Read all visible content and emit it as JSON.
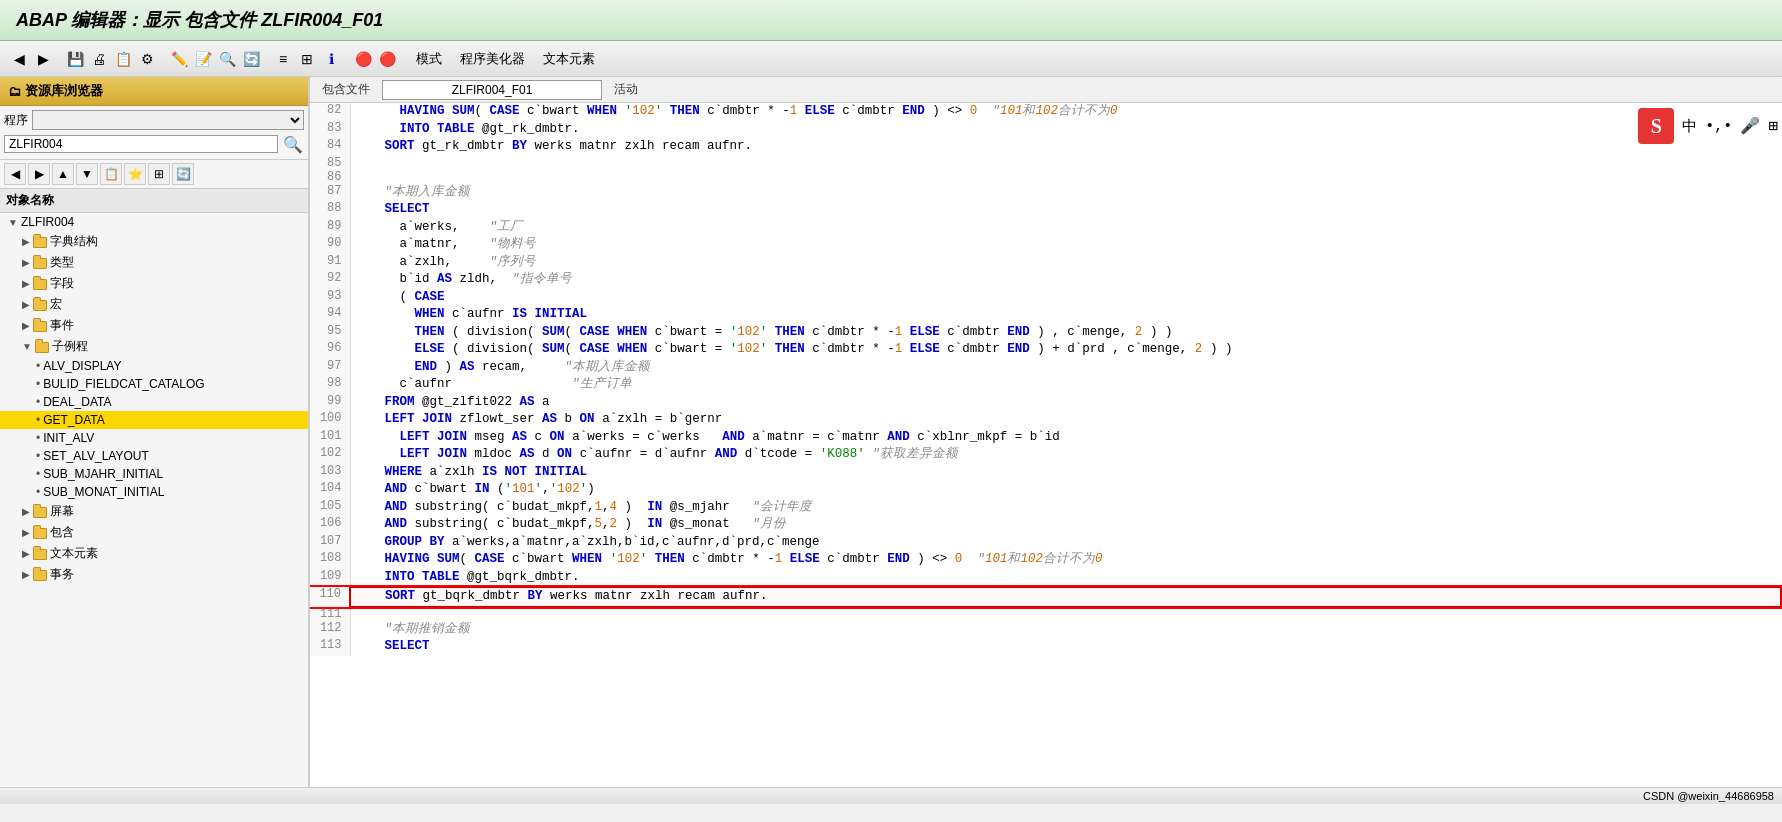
{
  "title": "ABAP 编辑器：显示 包含文件 ZLFIR004_F01",
  "toolbar": {
    "menu_items": [
      "模式",
      "程序美化器",
      "文本元素"
    ]
  },
  "sidebar": {
    "header": "资源库浏览器",
    "program_label": "程序",
    "program_value": "ZLFIR004",
    "object_label": "对象名称",
    "tree": [
      {
        "id": "root",
        "label": "ZLFIR004",
        "indent": 0,
        "selected": false,
        "arrow": "▼"
      },
      {
        "id": "dict",
        "label": "字典结构",
        "indent": 1,
        "arrow": "▶"
      },
      {
        "id": "types",
        "label": "类型",
        "indent": 1,
        "arrow": "▶"
      },
      {
        "id": "fields",
        "label": "字段",
        "indent": 1,
        "arrow": "▶"
      },
      {
        "id": "macros",
        "label": "宏",
        "indent": 1,
        "arrow": "▶"
      },
      {
        "id": "events",
        "label": "事件",
        "indent": 1,
        "arrow": "▶"
      },
      {
        "id": "subroutines",
        "label": "子例程",
        "indent": 1,
        "arrow": "▼"
      },
      {
        "id": "alv_display",
        "label": "ALV_DISPLAY",
        "indent": 2,
        "arrow": ""
      },
      {
        "id": "build_fieldcat",
        "label": "BULID_FIELDCAT_CATALOG",
        "indent": 2,
        "arrow": ""
      },
      {
        "id": "deal_data",
        "label": "DEAL_DATA",
        "indent": 2,
        "arrow": ""
      },
      {
        "id": "get_data",
        "label": "GET_DATA",
        "indent": 2,
        "arrow": "",
        "selected": true
      },
      {
        "id": "init_alv",
        "label": "INIT_ALV",
        "indent": 2,
        "arrow": ""
      },
      {
        "id": "set_alv_layout",
        "label": "SET_ALV_LAYOUT",
        "indent": 2,
        "arrow": ""
      },
      {
        "id": "sub_mjahr_initial",
        "label": "SUB_MJAHR_INITIAL",
        "indent": 2,
        "arrow": ""
      },
      {
        "id": "sub_monat_initial",
        "label": "SUB_MONAT_INITIAL",
        "indent": 2,
        "arrow": ""
      },
      {
        "id": "screen",
        "label": "屏幕",
        "indent": 1,
        "arrow": "▶"
      },
      {
        "id": "includes",
        "label": "包含",
        "indent": 1,
        "arrow": "▶"
      },
      {
        "id": "text_elements",
        "label": "文本元素",
        "indent": 1,
        "arrow": "▶"
      },
      {
        "id": "transactions",
        "label": "事务",
        "indent": 1,
        "arrow": "▶"
      }
    ]
  },
  "file_bar": {
    "label1": "包含文件",
    "file_value": "ZLFIR004_F01",
    "label2": "活动"
  },
  "code_lines": [
    {
      "num": "82",
      "code": "      HAVING SUM( CASE c`bwart WHEN '102' THEN c`dmbtr * -1 ELSE c`dmbtr END ) <> 0  \"101和102合计不为0"
    },
    {
      "num": "83",
      "code": "      INTO TABLE @gt_rk_dmbtr."
    },
    {
      "num": "84",
      "code": "    SORT gt_rk_dmbtr BY werks matnr zxlh recam aufnr."
    },
    {
      "num": "85",
      "code": ""
    },
    {
      "num": "86",
      "code": ""
    },
    {
      "num": "87",
      "code": "    \"本期入库金额"
    },
    {
      "num": "88",
      "code": "    SELECT"
    },
    {
      "num": "89",
      "code": "      a`werks,    \"工厂"
    },
    {
      "num": "90",
      "code": "      a`matnr,    \"物料号"
    },
    {
      "num": "91",
      "code": "      a`zxlh,     \"序列号"
    },
    {
      "num": "92",
      "code": "      b`id AS zldh,  \"指令单号"
    },
    {
      "num": "93",
      "code": "      ( CASE"
    },
    {
      "num": "94",
      "code": "        WHEN c`aufnr IS INITIAL"
    },
    {
      "num": "95",
      "code": "        THEN ( division( SUM( CASE WHEN c`bwart = '102' THEN c`dmbtr * -1 ELSE c`dmbtr END ) , c`menge, 2 ) )"
    },
    {
      "num": "96",
      "code": "        ELSE ( division( SUM( CASE WHEN c`bwart = '102' THEN c`dmbtr * -1 ELSE c`dmbtr END ) + d`prd , c`menge, 2 ) )"
    },
    {
      "num": "97",
      "code": "        END ) AS recam,     \"本期入库金额"
    },
    {
      "num": "98",
      "code": "      c`aufnr                \"生产订单"
    },
    {
      "num": "99",
      "code": "    FROM @gt_zlfit022 AS a"
    },
    {
      "num": "100",
      "code": "    LEFT JOIN zflowt_ser AS b ON a`zxlh = b`gernr"
    },
    {
      "num": "101",
      "code": "      LEFT JOIN mseg AS c ON a`werks = c`werks   AND a`matnr = c`matnr AND c`xblnr_mkpf = b`id"
    },
    {
      "num": "102",
      "code": "      LEFT JOIN mldoc AS d ON c`aufnr = d`aufnr AND d`tcode = 'K088' \"获取差异金额"
    },
    {
      "num": "103",
      "code": "    WHERE a`zxlh IS NOT INITIAL"
    },
    {
      "num": "104",
      "code": "    AND c`bwart IN ('101','102')"
    },
    {
      "num": "105",
      "code": "    AND substring( c`budat_mkpf,1,4 )  IN @s_mjahr   \"会计年度"
    },
    {
      "num": "106",
      "code": "    AND substring( c`budat_mkpf,5,2 )  IN @s_monat   \"月份"
    },
    {
      "num": "107",
      "code": "    GROUP BY a`werks,a`matnr,a`zxlh,b`id,c`aufnr,d`prd,c`menge"
    },
    {
      "num": "108",
      "code": "    HAVING SUM( CASE c`bwart WHEN '102' THEN c`dmbtr * -1 ELSE c`dmbtr END ) <> 0  \"101和102合计不为0"
    },
    {
      "num": "109",
      "code": "    INTO TABLE @gt_bqrk_dmbtr."
    },
    {
      "num": "110",
      "code": "    SORT gt_bqrk_dmbtr BY werks matnr zxlh recam aufnr.",
      "boxed": true
    },
    {
      "num": "111",
      "code": ""
    },
    {
      "num": "112",
      "code": "    \"本期推销金额"
    },
    {
      "num": "113",
      "code": "    SELECT"
    }
  ],
  "status_bar": {
    "text": "CSDN @weixin_44686958"
  }
}
